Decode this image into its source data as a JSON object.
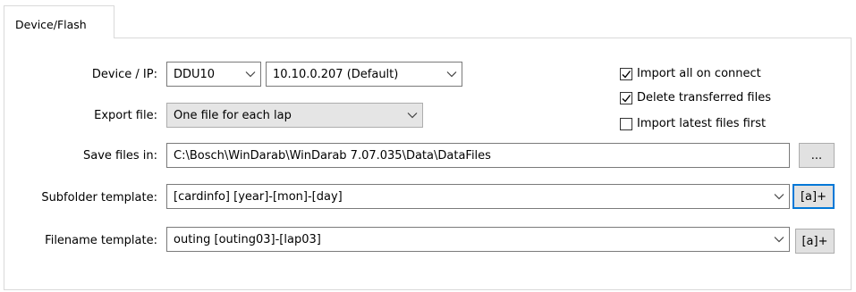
{
  "tab": {
    "label": "Device/Flash"
  },
  "device": {
    "label": "Device / IP:",
    "selected": "DDU10",
    "ip_selected": "10.10.0.207 (Default)"
  },
  "export": {
    "label": "Export file:",
    "selected": "One file for each lap"
  },
  "options": {
    "import_all_on_connect": {
      "label": "Import all on connect",
      "checked": true
    },
    "delete_transferred": {
      "label": "Delete transferred files",
      "checked": true
    },
    "import_latest_first": {
      "label": "Import latest files first",
      "checked": false
    }
  },
  "save": {
    "label": "Save files in:",
    "value": "C:\\Bosch\\WinDarab\\WinDarab 7.07.035\\Data\\DataFiles",
    "browse_label": "..."
  },
  "subfolder": {
    "label": "Subfolder template:",
    "value": "[cardinfo] [year]-[mon]-[day]",
    "insert_label": "[a]+"
  },
  "filename": {
    "label": "Filename template:",
    "value": "outing [outing03]-[lap03]",
    "insert_label": "[a]+"
  }
}
